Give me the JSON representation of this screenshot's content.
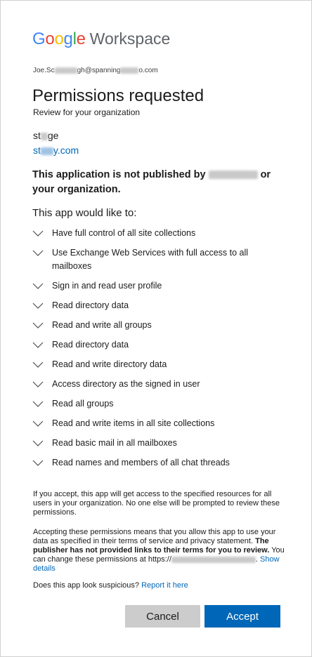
{
  "brand": {
    "google_letters": [
      {
        "char": "G",
        "color": "#4285F4"
      },
      {
        "char": "o",
        "color": "#EA4335"
      },
      {
        "char": "o",
        "color": "#FBBC05"
      },
      {
        "char": "g",
        "color": "#4285F4"
      },
      {
        "char": "l",
        "color": "#34A853"
      },
      {
        "char": "e",
        "color": "#EA4335"
      }
    ],
    "product": "Workspace"
  },
  "account": {
    "prefix": "Joe.Sc",
    "middle": "gh@spanning",
    "suffix": "o.com"
  },
  "header": {
    "title": "Permissions requested",
    "subtitle": "Review for your organization"
  },
  "app": {
    "name_start": "st",
    "name_end": "ge",
    "domain_start": "st",
    "domain_end": "y.com"
  },
  "warning": {
    "text_start": "This application is not published by",
    "text_end": "or your organization."
  },
  "permissions": {
    "intro": "This app would like to:",
    "items": [
      "Have full control of all site collections",
      "Use Exchange Web Services with full access to all mailboxes",
      "Sign in and read user profile",
      "Read directory data",
      "Read and write all groups",
      "Read directory data",
      "Read and write directory data",
      "Access directory as the signed in user",
      "Read all groups",
      "Read and write items in all site collections",
      "Read basic mail in all mailboxes",
      "Read names and members of all chat threads"
    ]
  },
  "notes": {
    "accept_note": "If you accept, this app will get access to the specified resources for all users in your organization. No one else will be prompted to review these permissions.",
    "terms_start": "Accepting these permissions means that you allow this app to use your data as specified in their terms of service and privacy statement.",
    "terms_bold": "The publisher has not provided links to their terms for you to review.",
    "terms_end": "You can change these permissions at https://",
    "show_details": "Show details",
    "suspicious_q": "Does this app look suspicious?",
    "report_link": "Report it here"
  },
  "buttons": {
    "cancel": "Cancel",
    "accept": "Accept"
  },
  "colors": {
    "accent": "#0067b8",
    "cancel_bg": "#cccccc",
    "border": "#cfcfcf"
  }
}
